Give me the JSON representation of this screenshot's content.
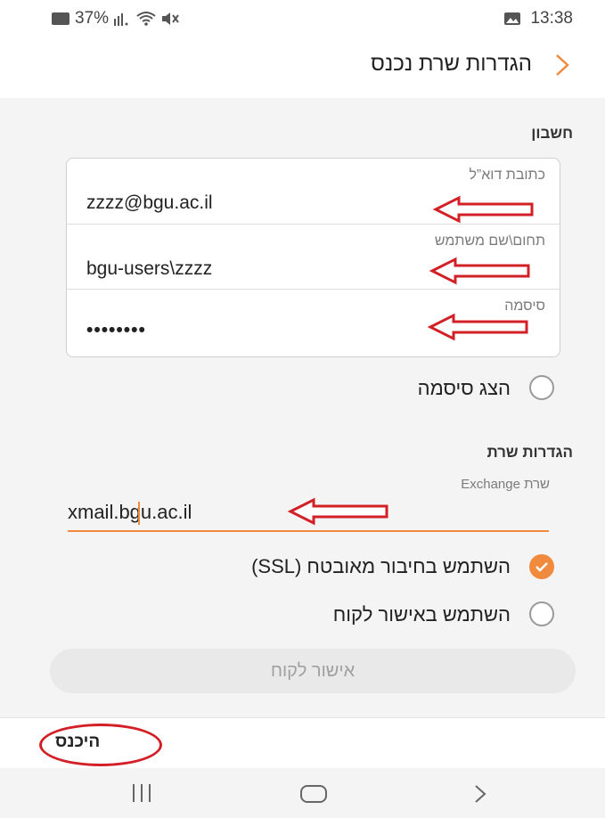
{
  "status_bar": {
    "battery": "37%",
    "time": "13:38"
  },
  "header": {
    "title": "הגדרות שרת נכנס"
  },
  "account": {
    "section_label": "חשבון",
    "email_label": "כתובת דוא”ל",
    "email_value": "zzzz@bgu.ac.il",
    "username_label": "תחום\\שם משתמש",
    "username_value": "bgu-users\\zzzz",
    "password_label": "סיסמה",
    "password_value": "••••••••",
    "show_password_label": "הצג סיסמה",
    "show_password_checked": false
  },
  "server": {
    "section_label": "הגדרות שרת",
    "server_label": "שרת Exchange",
    "server_value": "xmail.bgu.ac.il",
    "ssl_label": "השתמש בחיבור מאובטח (SSL)",
    "ssl_checked": true,
    "client_cert_label": "השתמש באישור לקוח",
    "client_cert_checked": false,
    "client_cert_button": "אישור לקוח"
  },
  "footer": {
    "login_label": "היכנס"
  },
  "colors": {
    "accent": "#f08a3c",
    "annotation": "#d32027",
    "section_bg": "#f4f4f4"
  },
  "icons": {
    "back": "chevron-left-icon",
    "battery": "battery-icon",
    "signal": "signal-icon",
    "wifi": "wifi-icon",
    "mute": "mute-icon",
    "gallery": "gallery-icon",
    "nav_recent": "recent-apps-icon",
    "nav_home": "home-icon",
    "nav_back": "nav-back-icon"
  }
}
